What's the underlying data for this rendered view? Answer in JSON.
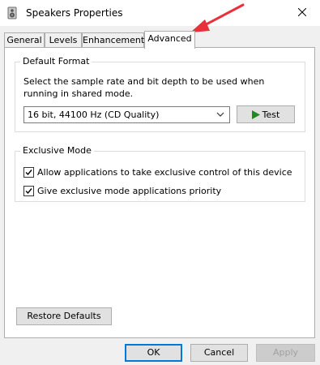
{
  "window": {
    "title": "Speakers Properties",
    "icon": "speaker-icon"
  },
  "tabs": [
    {
      "label": "General"
    },
    {
      "label": "Levels"
    },
    {
      "label": "Enhancements"
    },
    {
      "label": "Advanced",
      "active": true
    }
  ],
  "default_format": {
    "title": "Default Format",
    "description": "Select the sample rate and bit depth to be used when running in shared mode.",
    "selected_value": "16 bit, 44100 Hz (CD Quality)",
    "test_label": "Test"
  },
  "exclusive_mode": {
    "title": "Exclusive Mode",
    "options": [
      {
        "label": "Allow applications to take exclusive control of this device",
        "checked": true
      },
      {
        "label": "Give exclusive mode applications priority",
        "checked": true
      }
    ]
  },
  "restore_defaults_label": "Restore Defaults",
  "footer": {
    "ok": "OK",
    "cancel": "Cancel",
    "apply": "Apply"
  },
  "colors": {
    "accent": "#0078d7",
    "annotation_arrow": "#e8313a",
    "play_green": "#1f8a1f"
  }
}
